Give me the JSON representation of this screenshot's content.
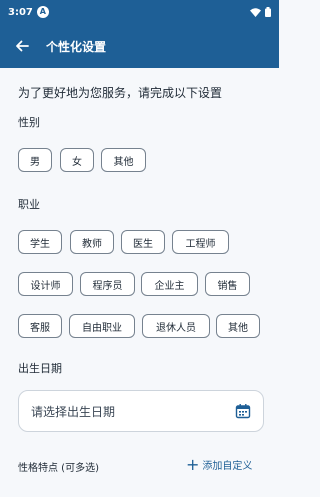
{
  "status_bar": {
    "time": "3:07",
    "badge": "A"
  },
  "app_bar": {
    "title": "个性化设置"
  },
  "intro": "为了更好地为您服务，请完成以下设置",
  "gender": {
    "label": "性别",
    "options": [
      "男",
      "女",
      "其他"
    ]
  },
  "occupation": {
    "label": "职业",
    "rows": [
      [
        "学生",
        "教师",
        "医生",
        "工程师"
      ],
      [
        "设计师",
        "程序员",
        "企业主",
        "销售"
      ],
      [
        "客服",
        "自由职业",
        "退休人员",
        "其他"
      ]
    ]
  },
  "birth_date": {
    "label": "出生日期",
    "placeholder": "请选择出生日期"
  },
  "traits": {
    "label": "性格特点 (可多选)",
    "add_label": "添加自定义"
  },
  "colors": {
    "primary": "#1e5f96",
    "chip_border": "#76828f",
    "background": "#f6f8fb"
  }
}
